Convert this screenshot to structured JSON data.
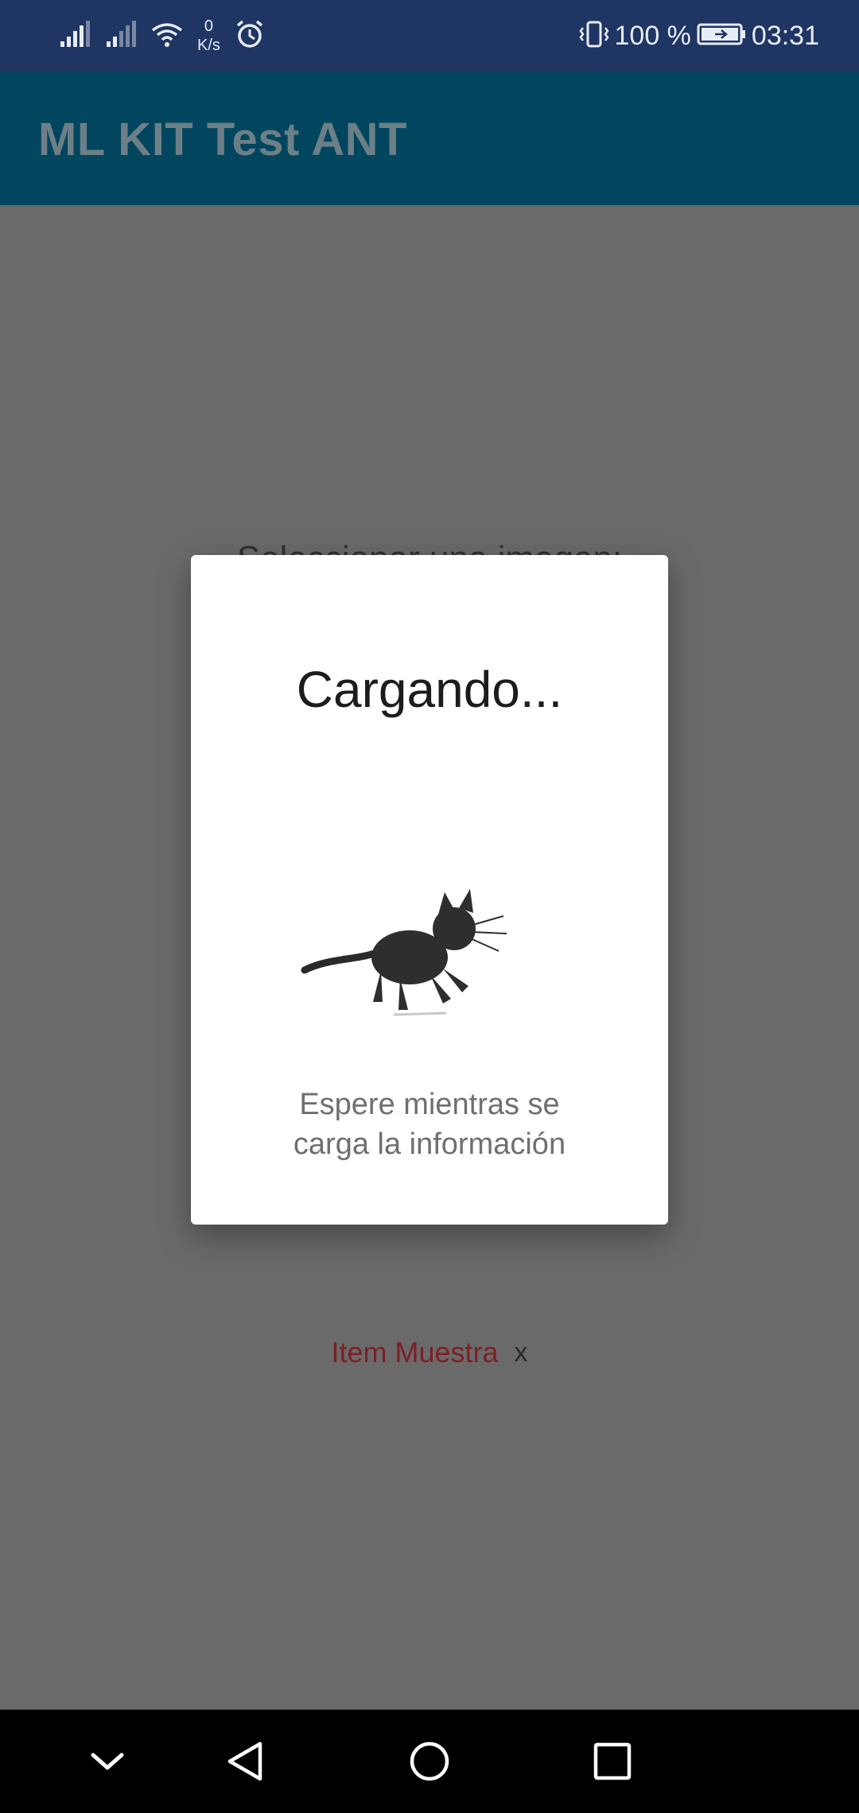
{
  "status_bar": {
    "speed_value": "0",
    "speed_unit": "K/s",
    "battery_percent": "100 %",
    "time": "03:31",
    "icons": [
      "signal-icon",
      "signal-icon",
      "wifi-icon",
      "alarm-icon",
      "vibrate-icon",
      "battery-icon"
    ]
  },
  "app_bar": {
    "title": "ML KIT Test ANT"
  },
  "main": {
    "select_label": "Seleccionar una imagen:",
    "chip": {
      "label": "Item Muestra",
      "close": "x"
    }
  },
  "dialog": {
    "title": "Cargando...",
    "illustration": "cat-icon",
    "message_line1": "Espere mientras se",
    "message_line2": "carga la información"
  },
  "nav_bar": {
    "icons": [
      "chevron-down-icon",
      "back-icon",
      "home-icon",
      "recents-icon"
    ]
  },
  "colors": {
    "status_bar": "#1f3563",
    "app_bar": "#01465e",
    "scrim": "#6a6a6a",
    "chip_label": "#7d1f24"
  }
}
